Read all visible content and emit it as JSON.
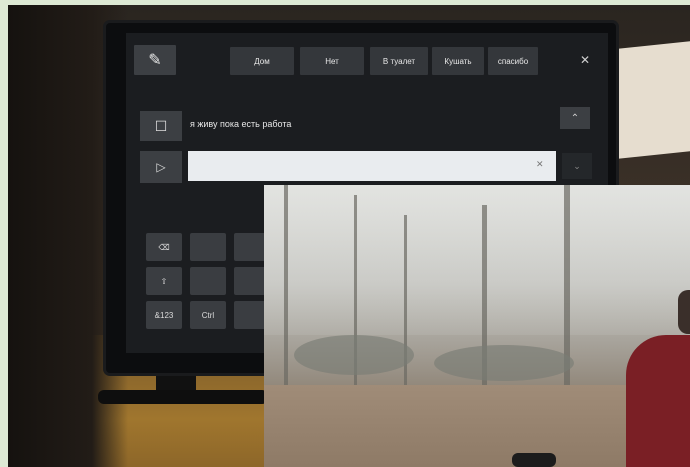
{
  "keyboard": {
    "suggestions": [
      "Дом",
      "Нет",
      "В туалет",
      "Кушать",
      "спасибо"
    ],
    "typed_text": "я живу пока есть работа",
    "input_value": "",
    "keys": [
      "⌫",
      "⇧",
      "&123",
      "Ctrl"
    ]
  },
  "icons": {
    "edit": "pencil-icon",
    "close": "close-icon",
    "stop": "stop-icon",
    "play": "play-icon",
    "up": "chevron-up-icon",
    "down": "chevron-down-icon"
  },
  "glyphs": {
    "pencil": "✎",
    "close": "✕",
    "stop": "☐",
    "play": "▷",
    "up": "⌃",
    "down": "⌄",
    "clear": "✕"
  }
}
